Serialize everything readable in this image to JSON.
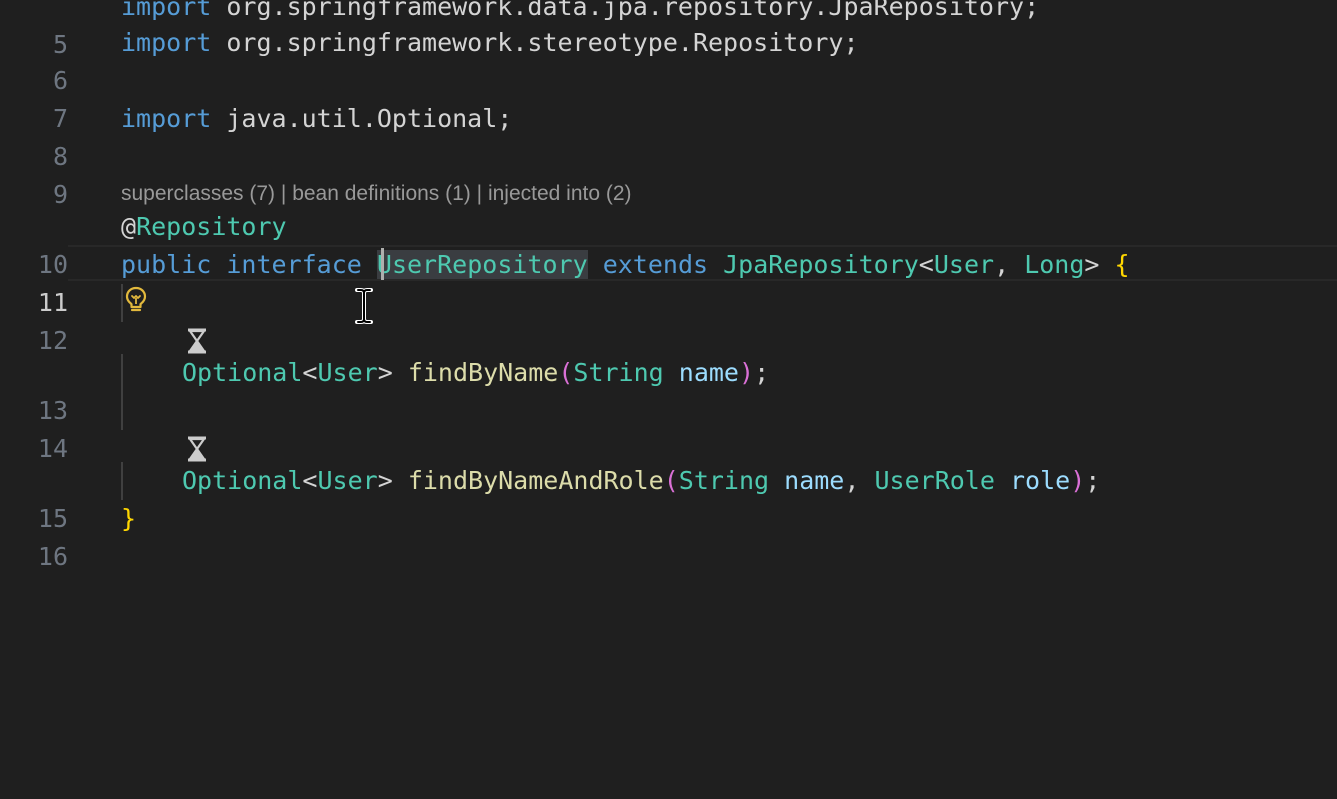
{
  "editor": {
    "codelens": {
      "superclasses": "superclasses (7)",
      "separator1": " | ",
      "bean_definitions": "bean definitions (1)",
      "separator2": " | ",
      "injected_into": "injected into (2)"
    },
    "line_numbers": [
      "5",
      "6",
      "7",
      "8",
      "9",
      "10",
      "11",
      "12",
      "13",
      "14",
      "15",
      "16"
    ],
    "active_line": "11",
    "lines": {
      "l5": {
        "kw": "import",
        "rest": " org.springframework.data.jpa.repository.JpaRepository;"
      },
      "l6": {
        "kw": "import",
        "rest": " org.springframework.stereotype.Repository;"
      },
      "l8": {
        "kw": "import",
        "rest": " java.util.Optional;"
      },
      "l10": {
        "at": "@",
        "annotation": "Repository"
      },
      "l11": {
        "kw1": "public",
        "kw2": "interface",
        "name": "UserRepository",
        "kw3": "extends",
        "super": "JpaRepository",
        "lt": "<",
        "arg1": "User",
        "comma": ",",
        "arg2": "Long",
        "gt": ">",
        "brace": "{"
      },
      "l13": {
        "ret": "Optional",
        "lt": "<",
        "ret_arg": "User",
        "gt": ">",
        "method": "findByName",
        "lp": "(",
        "p1_type": "String",
        "p1_name": "name",
        "rp": ")",
        "semi": ";"
      },
      "l15": {
        "ret": "Optional",
        "lt": "<",
        "ret_arg": "User",
        "gt": ">",
        "method": "findByNameAndRole",
        "lp": "(",
        "p1_type": "String",
        "p1_name": "name",
        "comma": ",",
        "p2_type": "UserRole",
        "p2_name": "role",
        "rp": ")",
        "semi": ";"
      },
      "l16": {
        "brace": "}"
      }
    },
    "icons": {
      "lightbulb": "lightbulb-icon",
      "hourglass": "hourglass-icon",
      "cursor": "text-cursor-icon"
    },
    "colors": {
      "background": "#1f1f1f",
      "keyword": "#569cd6",
      "type": "#4ec9b0",
      "function": "#dcdcaa",
      "parameter": "#9cdcfe",
      "bracket_yellow": "#ffd700",
      "bracket_purple": "#da70d6"
    }
  }
}
